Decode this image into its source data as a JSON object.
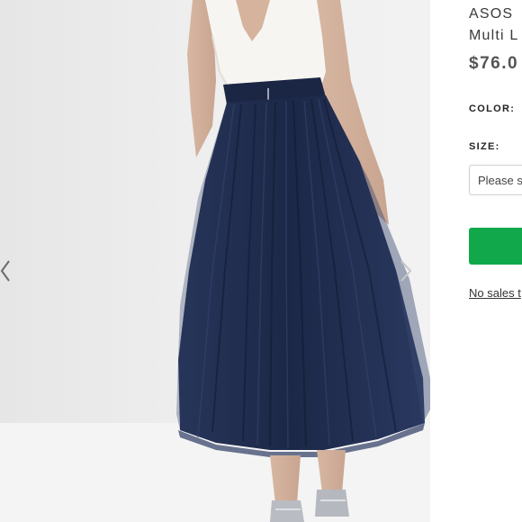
{
  "listing": {
    "title_line1": "ASOS",
    "title_line2": "Multi L",
    "price": "$76.0",
    "color_label": "COLOR:",
    "size_label": "SIZE:",
    "size_select": {
      "value": "Please se"
    },
    "tax_note": "No sales t"
  },
  "colors": {
    "buy_button": "#11a84c",
    "skirt": "#1e2b4c",
    "top": "#f7f5f2"
  },
  "icons": {
    "prev": "chevron-left-icon",
    "next": "chevron-right-icon"
  }
}
